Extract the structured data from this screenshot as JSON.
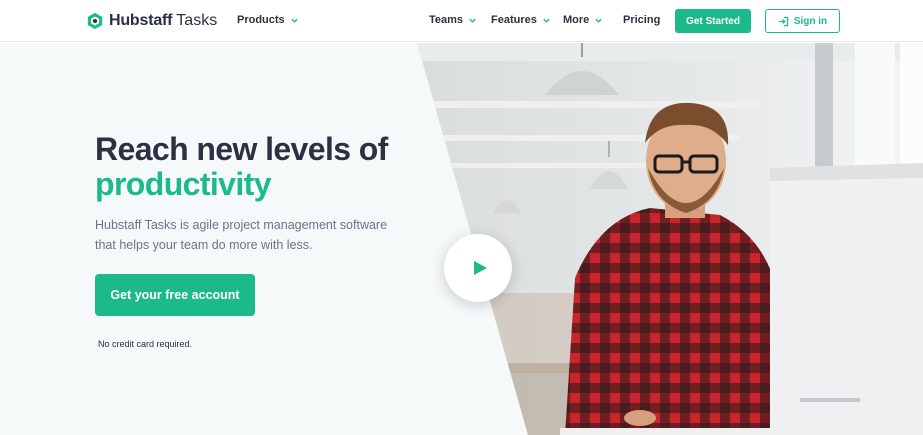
{
  "header": {
    "logo_word": "Hubstaff",
    "logo_sub": "Tasks",
    "nav": {
      "products": "Products",
      "teams": "Teams",
      "features": "Features",
      "more": "More",
      "pricing": "Pricing"
    },
    "get_started": "Get Started",
    "sign_in": "Sign in"
  },
  "hero": {
    "headline_line1": "Reach new levels of",
    "headline_accent": "productivity",
    "subtext": "Hubstaff Tasks is agile project management software that helps your team do more with less.",
    "cta_label": "Get your free account",
    "fineprint": "No credit card required."
  },
  "colors": {
    "brand_green": "#1cb98a",
    "heading_navy": "#2b3042",
    "body_gray": "#6c7385",
    "hero_bg": "#f5f9fa"
  },
  "icons": {
    "logo": "hubstaff-logo-icon",
    "chevron": "chevron-down-icon",
    "sign_in": "sign-in-icon",
    "play": "play-icon"
  }
}
